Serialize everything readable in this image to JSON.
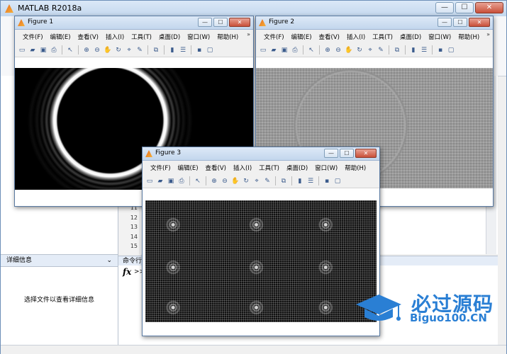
{
  "app": {
    "title": "MATLAB R2018a"
  },
  "main_window_buttons": {
    "minimize": "—",
    "maximize": "☐",
    "close": "✕"
  },
  "left_panel": {
    "detail_header": "详细信息",
    "detail_hint": "选择文件以查看详细信息"
  },
  "editor": {
    "line_numbers": [
      "11",
      "12",
      "13",
      "14",
      "15"
    ]
  },
  "command_window": {
    "header": "命令行",
    "fx": "fx",
    "prompt": ">>"
  },
  "figures": [
    {
      "title": "Figure 1",
      "menu": [
        "文件(F)",
        "编辑(E)",
        "查看(V)",
        "插入(I)",
        "工具(T)",
        "桌面(D)",
        "窗口(W)",
        "帮助(H)"
      ],
      "expand": "»",
      "image": "bright-ring"
    },
    {
      "title": "Figure 2",
      "menu": [
        "文件(F)",
        "编辑(E)",
        "查看(V)",
        "插入(I)",
        "工具(T)",
        "桌面(D)",
        "窗口(W)",
        "帮助(H)"
      ],
      "expand": "»",
      "image": "gray-phase"
    },
    {
      "title": "Figure 3",
      "menu": [
        "文件(F)",
        "编辑(E)",
        "查看(V)",
        "插入(I)",
        "工具(T)",
        "桌面(D)",
        "窗口(W)",
        "帮助(H)"
      ],
      "expand": "",
      "image": "ring-array"
    }
  ],
  "figure_buttons": {
    "minimize": "—",
    "maximize": "☐",
    "close": "✕"
  },
  "toolbar_icons": [
    "new-file-icon",
    "open-icon",
    "save-icon",
    "print-icon",
    "pointer-icon",
    "zoom-in-icon",
    "zoom-out-icon",
    "pan-icon",
    "rotate-icon",
    "data-cursor-icon",
    "brush-icon",
    "link-icon",
    "colorbar-icon",
    "legend-icon",
    "hide-plot-tools-icon",
    "show-plot-tools-icon"
  ],
  "watermark": {
    "chinese": "必过源码",
    "english": "Biguo100.CN"
  },
  "colors": {
    "accent": "#2a7fd4",
    "titlebar": "#c4d8ee",
    "close": "#c9503a"
  }
}
